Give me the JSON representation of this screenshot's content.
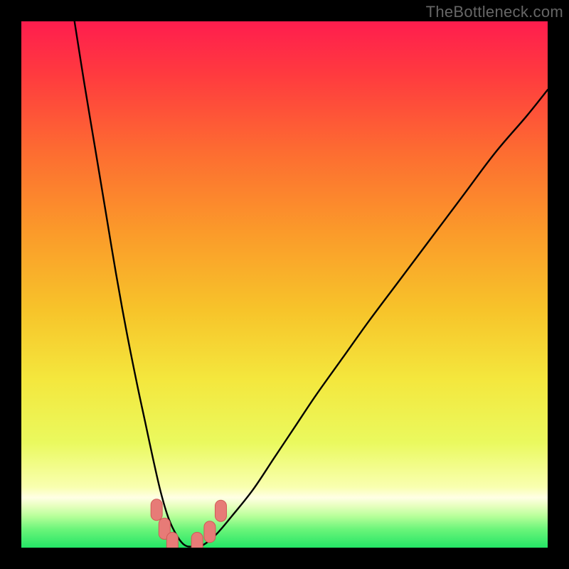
{
  "watermark": "TheBottleneck.com",
  "colors": {
    "frame": "#000000",
    "curve": "#000000",
    "marker_fill": "#e77b77",
    "marker_stroke": "#d15a56",
    "gradient_stops": [
      {
        "offset": 0.0,
        "color": "#ff1d4e"
      },
      {
        "offset": 0.1,
        "color": "#ff3a3f"
      },
      {
        "offset": 0.25,
        "color": "#fd6d31"
      },
      {
        "offset": 0.4,
        "color": "#fb9a2a"
      },
      {
        "offset": 0.55,
        "color": "#f7c42a"
      },
      {
        "offset": 0.68,
        "color": "#f4e73d"
      },
      {
        "offset": 0.8,
        "color": "#eaf95e"
      },
      {
        "offset": 0.885,
        "color": "#f9ffb0"
      },
      {
        "offset": 0.905,
        "color": "#ffffe5"
      },
      {
        "offset": 0.92,
        "color": "#e8ffc0"
      },
      {
        "offset": 0.94,
        "color": "#b8ff9a"
      },
      {
        "offset": 0.965,
        "color": "#6bf57a"
      },
      {
        "offset": 1.0,
        "color": "#24e566"
      }
    ]
  },
  "chart_data": {
    "type": "line",
    "title": "",
    "xlabel": "",
    "ylabel": "",
    "xlim": [
      0,
      100
    ],
    "ylim": [
      0,
      100
    ],
    "grid": false,
    "note": "Axes are unlabeled in source image; values are estimated positions in percent of plot area (x left→right, y = bottleneck %).",
    "series": [
      {
        "name": "bottleneck-curve",
        "x": [
          10.1,
          12,
          14,
          16,
          18,
          20,
          22,
          23.5,
          25,
          26.5,
          28,
          29.6,
          31,
          32.5,
          34.5,
          37,
          40,
          44,
          48,
          52,
          56,
          61,
          66,
          72,
          78,
          84,
          90,
          96,
          100
        ],
        "y": [
          100,
          88,
          76,
          64,
          52,
          41,
          31,
          24,
          17,
          10.5,
          5.5,
          2.2,
          0.5,
          0.2,
          0.5,
          2.5,
          6,
          11,
          17,
          23,
          29,
          36,
          43,
          51,
          59,
          67,
          75,
          82,
          87
        ]
      }
    ],
    "markers": {
      "name": "highlighted-points",
      "points": [
        {
          "x": 25.7,
          "y": 7.2
        },
        {
          "x": 27.2,
          "y": 3.6
        },
        {
          "x": 28.7,
          "y": 0.9
        },
        {
          "x": 33.4,
          "y": 0.9
        },
        {
          "x": 35.8,
          "y": 3.0
        },
        {
          "x": 37.9,
          "y": 7.0
        }
      ]
    }
  }
}
